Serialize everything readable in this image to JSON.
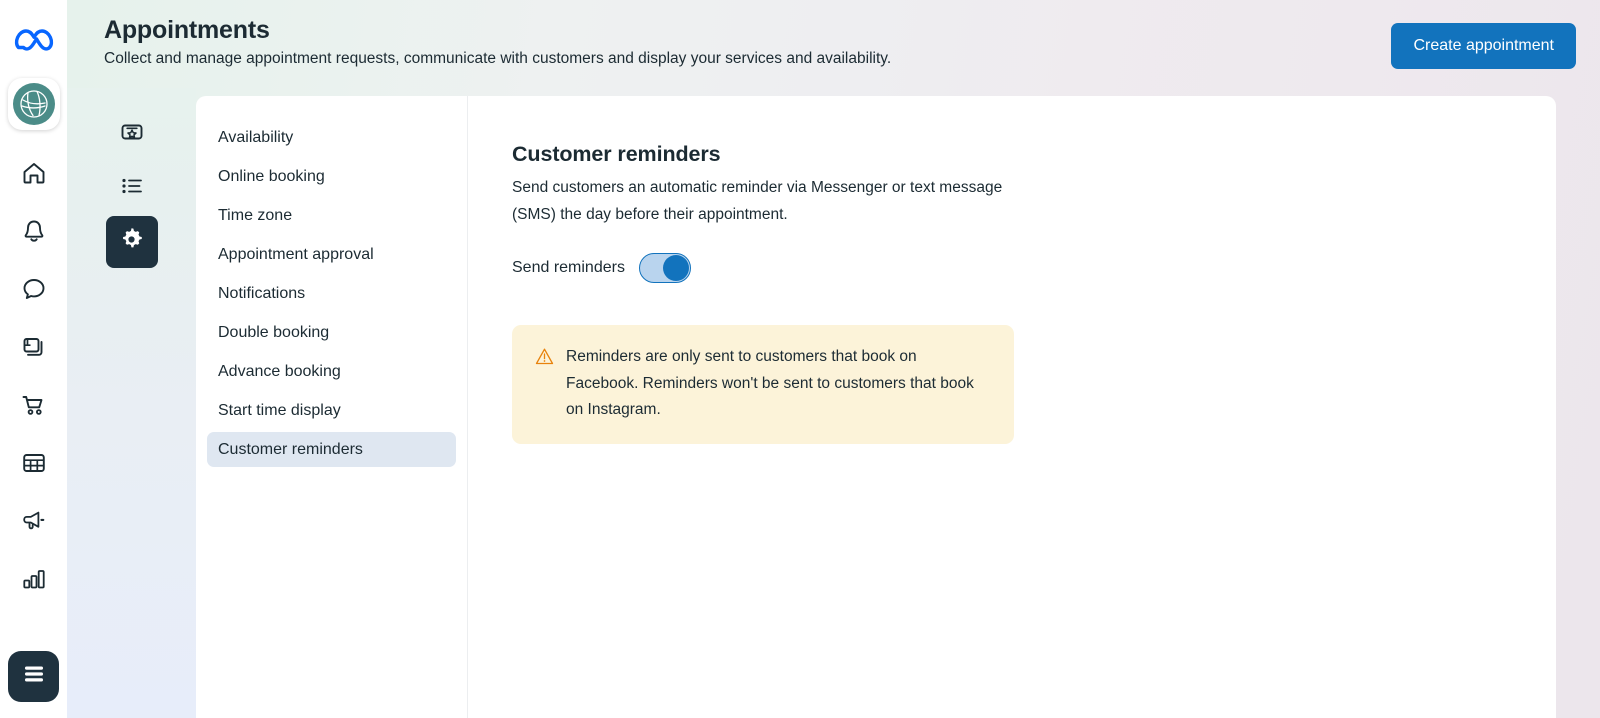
{
  "brand": {
    "logo_icon": "meta-infinity-logo",
    "logo_color": "#0866ff",
    "avatar_icon": "business-avatar",
    "avatar_color": "#4b8c88"
  },
  "left_rail": {
    "items": [
      {
        "icon": "home-icon",
        "label": "Home"
      },
      {
        "icon": "bell-icon",
        "label": "Notifications"
      },
      {
        "icon": "chat-bubble-icon",
        "label": "Inbox"
      },
      {
        "icon": "posts-icon",
        "label": "Content"
      },
      {
        "icon": "cart-icon",
        "label": "Commerce"
      },
      {
        "icon": "calendar-grid-icon",
        "label": "Planner"
      },
      {
        "icon": "megaphone-icon",
        "label": "Ads"
      },
      {
        "icon": "bar-chart-icon",
        "label": "Insights"
      }
    ],
    "menu_icon": "hamburger-menu-icon"
  },
  "header": {
    "title": "Appointments",
    "subtitle": "Collect and manage appointment requests, communicate with customers and display your services and availability.",
    "create_button": "Create appointment",
    "create_button_color": "#1273bd"
  },
  "section_rail": {
    "items": [
      {
        "icon": "card-star-icon",
        "label": "Overview",
        "active": false
      },
      {
        "icon": "bullet-list-icon",
        "label": "Appointment list",
        "active": false
      },
      {
        "icon": "gear-icon",
        "label": "Settings",
        "active": true
      }
    ],
    "active_color": "#1f323f"
  },
  "settings_nav": {
    "items": [
      {
        "label": "Availability",
        "selected": false
      },
      {
        "label": "Online booking",
        "selected": false
      },
      {
        "label": "Time zone",
        "selected": false
      },
      {
        "label": "Appointment approval",
        "selected": false
      },
      {
        "label": "Notifications",
        "selected": false
      },
      {
        "label": "Double booking",
        "selected": false
      },
      {
        "label": "Advance booking",
        "selected": false
      },
      {
        "label": "Start time display",
        "selected": false
      },
      {
        "label": "Customer reminders",
        "selected": true
      }
    ],
    "selected_bg": "#dfe7f1"
  },
  "detail": {
    "title": "Customer reminders",
    "description": "Send customers an automatic reminder via Messenger or text message (SMS) the day before their appointment.",
    "toggle_label": "Send reminders",
    "toggle_state": "on",
    "toggle_color": "#1273bd",
    "notice": {
      "icon": "warning-triangle-icon",
      "icon_color": "#e8820c",
      "bg_color": "#fcf3d9",
      "text": "Reminders are only sent to customers that book on Facebook. Reminders won't be sent to customers that book on Instagram."
    }
  }
}
